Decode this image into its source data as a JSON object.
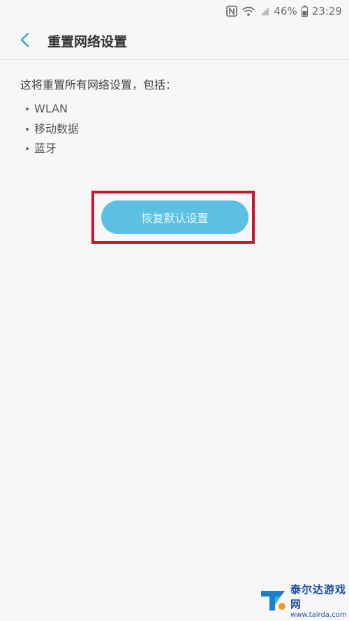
{
  "statusbar": {
    "battery": "46%",
    "time": "23:29"
  },
  "header": {
    "title": "重置网络设置"
  },
  "content": {
    "intro": "这将重置所有网络设置，包括：",
    "items": [
      "WLAN",
      "移动数据",
      "蓝牙"
    ]
  },
  "reset_button": {
    "label": "恢复默认设置"
  },
  "watermark": {
    "name": "泰尔达游戏网",
    "url": "www.tairda.com"
  },
  "colors": {
    "accent": "#5bc0e2",
    "back_arrow": "#3aa7c2",
    "highlight": "#c8172a",
    "background": "#f7f7f9"
  }
}
